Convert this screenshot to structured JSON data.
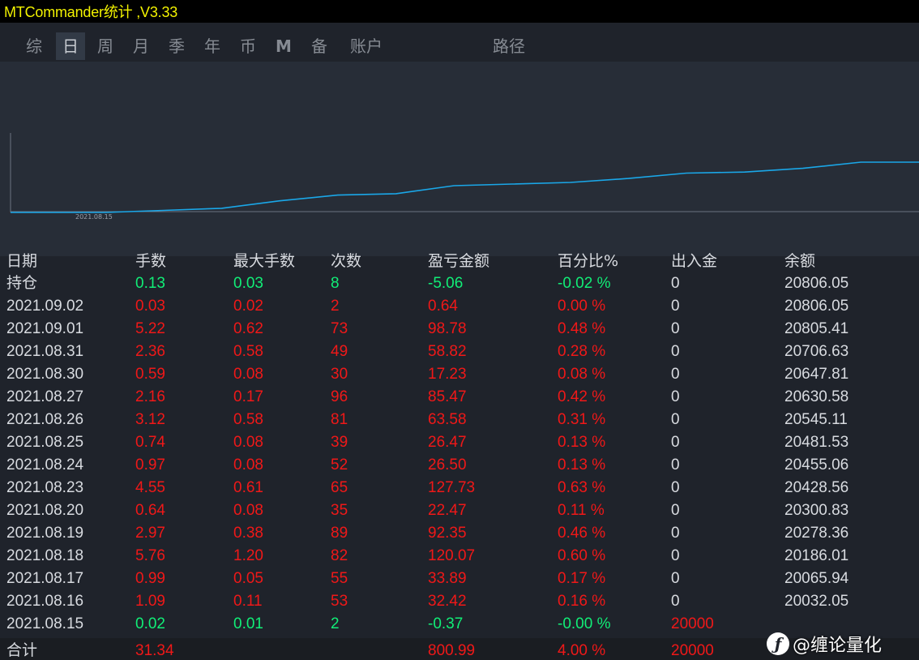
{
  "window": {
    "title": "MTCommander统计 ,V3.33"
  },
  "tabs": [
    {
      "label": "综",
      "active": false
    },
    {
      "label": "日",
      "active": true
    },
    {
      "label": "周",
      "active": false
    },
    {
      "label": "月",
      "active": false
    },
    {
      "label": "季",
      "active": false
    },
    {
      "label": "年",
      "active": false
    },
    {
      "label": "币",
      "active": false
    },
    {
      "label": "M",
      "active": false
    },
    {
      "label": "备",
      "active": false
    },
    {
      "label": "账户",
      "active": false
    },
    {
      "label": "路径",
      "active": false
    }
  ],
  "colors": {
    "accent_line": "#1aa7e8",
    "title_yellow": "#f2f200",
    "loss_red": "#f01818",
    "gain_green": "#11ee77"
  },
  "chart_data": {
    "type": "line",
    "x_label_shown": "2021.08.15",
    "series": [
      {
        "x": [
          "2021.08.15",
          "2021.08.16",
          "2021.08.17",
          "2021.08.18",
          "2021.08.19",
          "2021.08.20",
          "2021.08.23",
          "2021.08.24",
          "2021.08.25",
          "2021.08.26",
          "2021.08.27",
          "2021.08.30",
          "2021.08.31",
          "2021.09.01",
          "2021.09.02"
        ],
        "values": [
          20000,
          20032.05,
          20065.94,
          20186.01,
          20278.36,
          20300.83,
          20428.56,
          20455.06,
          20481.53,
          20545.11,
          20630.58,
          20647.81,
          20706.63,
          20805.41,
          20806.05
        ]
      }
    ]
  },
  "table": {
    "headers": [
      "日期",
      "手数",
      "最大手数",
      "次数",
      "盈亏金额",
      "百分比%",
      "出入金",
      "余额"
    ],
    "rows": [
      {
        "date": "持仓",
        "lots": "0.13",
        "max_lots": "0.03",
        "count": "8",
        "pnl": "-5.06",
        "pct": "-0.02 %",
        "deposit": "0",
        "balance": "20806.05",
        "tone": "g"
      },
      {
        "date": "2021.09.02",
        "lots": "0.03",
        "max_lots": "0.02",
        "count": "2",
        "pnl": "0.64",
        "pct": "0.00 %",
        "deposit": "0",
        "balance": "20806.05",
        "tone": "r"
      },
      {
        "date": "2021.09.01",
        "lots": "5.22",
        "max_lots": "0.62",
        "count": "73",
        "pnl": "98.78",
        "pct": "0.48 %",
        "deposit": "0",
        "balance": "20805.41",
        "tone": "r"
      },
      {
        "date": "2021.08.31",
        "lots": "2.36",
        "max_lots": "0.58",
        "count": "49",
        "pnl": "58.82",
        "pct": "0.28 %",
        "deposit": "0",
        "balance": "20706.63",
        "tone": "r"
      },
      {
        "date": "2021.08.30",
        "lots": "0.59",
        "max_lots": "0.08",
        "count": "30",
        "pnl": "17.23",
        "pct": "0.08 %",
        "deposit": "0",
        "balance": "20647.81",
        "tone": "r"
      },
      {
        "date": "2021.08.27",
        "lots": "2.16",
        "max_lots": "0.17",
        "count": "96",
        "pnl": "85.47",
        "pct": "0.42 %",
        "deposit": "0",
        "balance": "20630.58",
        "tone": "r"
      },
      {
        "date": "2021.08.26",
        "lots": "3.12",
        "max_lots": "0.58",
        "count": "81",
        "pnl": "63.58",
        "pct": "0.31 %",
        "deposit": "0",
        "balance": "20545.11",
        "tone": "r"
      },
      {
        "date": "2021.08.25",
        "lots": "0.74",
        "max_lots": "0.08",
        "count": "39",
        "pnl": "26.47",
        "pct": "0.13 %",
        "deposit": "0",
        "balance": "20481.53",
        "tone": "r"
      },
      {
        "date": "2021.08.24",
        "lots": "0.97",
        "max_lots": "0.08",
        "count": "52",
        "pnl": "26.50",
        "pct": "0.13 %",
        "deposit": "0",
        "balance": "20455.06",
        "tone": "r"
      },
      {
        "date": "2021.08.23",
        "lots": "4.55",
        "max_lots": "0.61",
        "count": "65",
        "pnl": "127.73",
        "pct": "0.63 %",
        "deposit": "0",
        "balance": "20428.56",
        "tone": "r"
      },
      {
        "date": "2021.08.20",
        "lots": "0.64",
        "max_lots": "0.08",
        "count": "35",
        "pnl": "22.47",
        "pct": "0.11 %",
        "deposit": "0",
        "balance": "20300.83",
        "tone": "r"
      },
      {
        "date": "2021.08.19",
        "lots": "2.97",
        "max_lots": "0.38",
        "count": "89",
        "pnl": "92.35",
        "pct": "0.46 %",
        "deposit": "0",
        "balance": "20278.36",
        "tone": "r"
      },
      {
        "date": "2021.08.18",
        "lots": "5.76",
        "max_lots": "1.20",
        "count": "82",
        "pnl": "120.07",
        "pct": "0.60 %",
        "deposit": "0",
        "balance": "20186.01",
        "tone": "r"
      },
      {
        "date": "2021.08.17",
        "lots": "0.99",
        "max_lots": "0.05",
        "count": "55",
        "pnl": "33.89",
        "pct": "0.17 %",
        "deposit": "0",
        "balance": "20065.94",
        "tone": "r"
      },
      {
        "date": "2021.08.16",
        "lots": "1.09",
        "max_lots": "0.11",
        "count": "53",
        "pnl": "32.42",
        "pct": "0.16 %",
        "deposit": "0",
        "balance": "20032.05",
        "tone": "r"
      },
      {
        "date": "2021.08.15",
        "lots": "0.02",
        "max_lots": "0.01",
        "count": "2",
        "pnl": "-0.37",
        "pct": "-0.00 %",
        "deposit": "20000",
        "balance": "",
        "tone": "g",
        "deposit_tone": "r"
      }
    ],
    "total": {
      "label": "合计",
      "lots": "31.34",
      "max_lots": "",
      "count": "",
      "pnl": "800.99",
      "pct": "4.00 %",
      "deposit": "20000",
      "balance": ""
    }
  },
  "watermark": {
    "icon": "zhihu-logo-icon",
    "text": "@缠论量化"
  }
}
